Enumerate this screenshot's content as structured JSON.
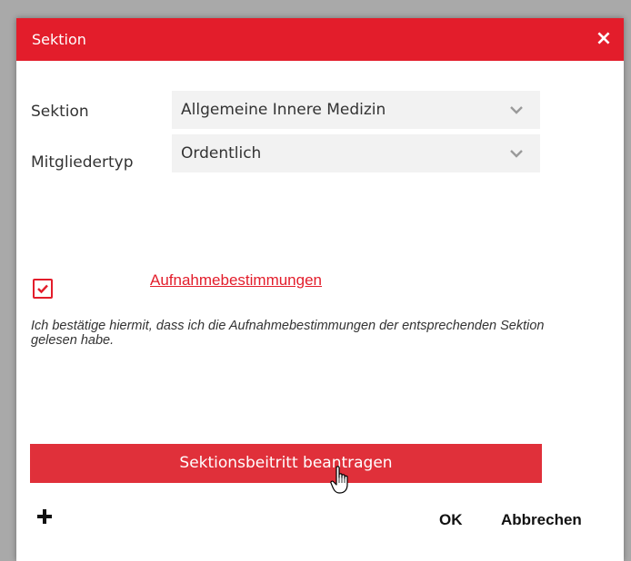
{
  "dialog": {
    "title": "Sektion",
    "close_label": "×"
  },
  "form": {
    "section": {
      "label": "Sektion",
      "value": "Allgemeine Innere Medizin"
    },
    "member_type": {
      "label": "Mitgliedertyp",
      "value": "Ordentlich"
    },
    "terms_link": "Aufnahmebestimmungen",
    "terms_checked": true,
    "confirm_text": "Ich bestätige hiermit, dass ich die Aufnahmebestimmungen der entsprechenden Sektion gelesen habe."
  },
  "actions": {
    "join_label": "Sektionsbeitritt beantragen",
    "ok_label": "OK",
    "cancel_label": "Abbrechen"
  },
  "colors": {
    "accent": "#e31d2b",
    "button": "#e0303a",
    "select_bg": "#f2f2f2"
  },
  "icons": {
    "add": "plus-icon",
    "dropdown": "chevron-down-icon",
    "check": "checkmark-icon",
    "close": "close-icon",
    "cursor": "hand-cursor-icon"
  }
}
